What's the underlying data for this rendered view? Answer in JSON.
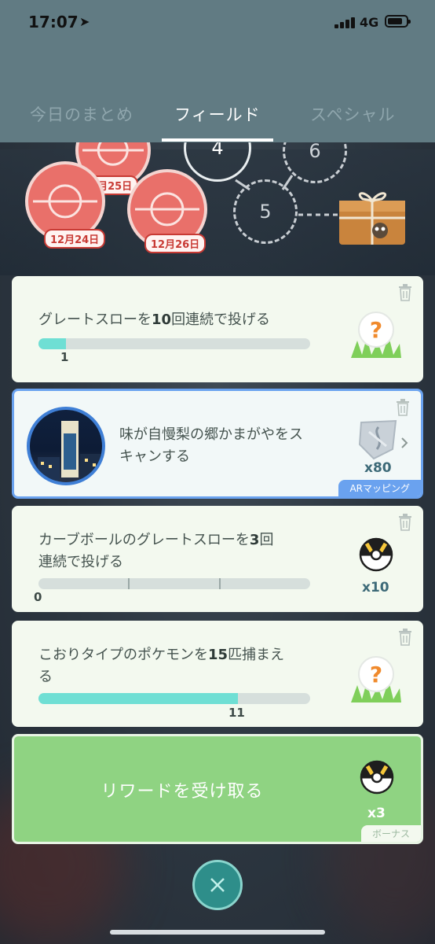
{
  "status_bar": {
    "time": "17:07",
    "network": "4G"
  },
  "tabs": [
    {
      "label": "今日のまとめ",
      "active": false
    },
    {
      "label": "フィールド",
      "active": true
    },
    {
      "label": "スペシャル",
      "active": false
    }
  ],
  "stamps": {
    "dates": [
      "12月25日",
      "12月24日",
      "12月26日"
    ],
    "numbers": [
      "4",
      "6",
      "5"
    ]
  },
  "tasks": [
    {
      "title_parts": [
        "グレートスローを",
        "10",
        "回連続で投げる"
      ],
      "progress_value": "1",
      "progress_fraction": 0.1,
      "reward_icon": "mystery-encounter-icon"
    },
    {
      "title": "味が自慢梨の郷かまがやをスキャンする",
      "title_line1": "味が自慢梨の郷かまがやをス",
      "title_line2": "キャンする",
      "reward_icon": "rare-candy-gem-icon",
      "reward_count": "x80",
      "tag": "ARマッピング"
    },
    {
      "title_line1_parts": [
        "カーブボールのグレートスローを",
        "3",
        "回"
      ],
      "title_line2": "連続で投げる",
      "progress_value": "0",
      "progress_fraction": 0,
      "reward_icon": "ultra-ball-icon",
      "reward_count": "x10"
    },
    {
      "title_line1_parts": [
        "こおりタイプのポケモンを",
        "15",
        "匹捕まえ"
      ],
      "title_line2": "る",
      "progress_value": "11",
      "progress_fraction": 0.733,
      "reward_icon": "mystery-encounter-icon"
    }
  ],
  "claim": {
    "label": "リワードを受け取る",
    "reward_icon": "ultra-ball-icon",
    "reward_count": "x3",
    "tag": "ボーナス"
  },
  "colors": {
    "header": "#617b83",
    "card": "#f3f9ef",
    "progress_fill": "#6fdfd4",
    "ar_accent": "#6aa2ef",
    "claim": "#8fd382"
  }
}
